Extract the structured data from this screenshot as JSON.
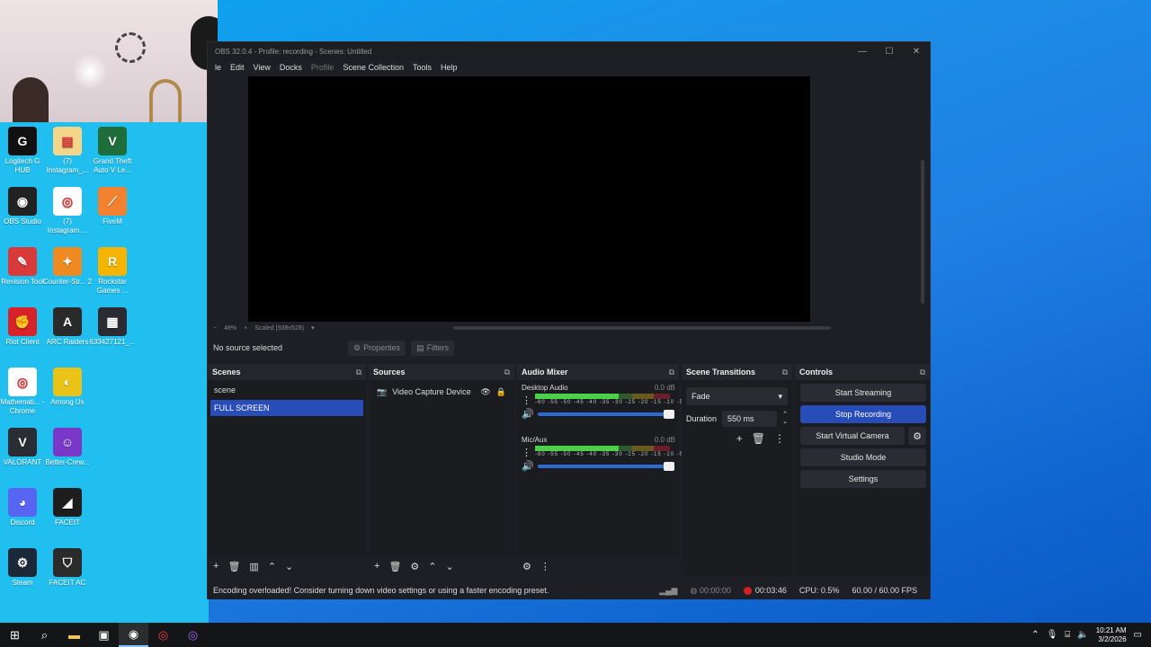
{
  "window": {
    "title": "OBS 32.0.4 - Profile: recording - Scenes: Untitled"
  },
  "menu": [
    "le",
    "Edit",
    "View",
    "Docks",
    "Profile",
    "Scene Collection",
    "Tools",
    "Help"
  ],
  "preview": {
    "zoom": "48%",
    "scale_mode": "Scaled (939x528)"
  },
  "source_bar": {
    "status": "No source selected",
    "properties": "Properties",
    "filters": "Filters"
  },
  "scenes": {
    "title": "Scenes",
    "items": [
      "scene",
      "FULL SCREEN"
    ],
    "selected": 1
  },
  "sources": {
    "title": "Sources",
    "items": [
      "Video Capture Device"
    ]
  },
  "mixer": {
    "title": "Audio Mixer",
    "channels": [
      {
        "name": "Desktop Audio",
        "db": "0.0 dB",
        "level": 0.62
      },
      {
        "name": "Mic/Aux",
        "db": "0.0 dB",
        "level": 0.62
      }
    ],
    "ticks": "-60 -55 -50 -45 -40 -35 -30 -25 -20 -15 -10 -5 0"
  },
  "transitions": {
    "title": "Scene Transitions",
    "type": "Fade",
    "duration_label": "Duration",
    "duration": "550 ms"
  },
  "controls": {
    "title": "Controls",
    "start_streaming": "Start Streaming",
    "stop_recording": "Stop Recording",
    "start_virtual_camera": "Start Virtual Camera",
    "studio_mode": "Studio Mode",
    "settings": "Settings"
  },
  "status": {
    "message": "Encoding overloaded! Consider turning down video settings or using a faster encoding preset.",
    "stream_time": "00:00:00",
    "rec_time": "00:03:46",
    "cpu": "CPU: 0.5%",
    "fps": "60.00 / 60.00 FPS"
  },
  "desktop_icons": [
    {
      "label": "Logitech G HUB",
      "color": "#111",
      "glyph": "G"
    },
    {
      "label": "(7) Instagram_...",
      "color": "#f4d68a",
      "glyph": "▤"
    },
    {
      "label": "Grand Theft Auto V Le...",
      "color": "#1f6d3a",
      "glyph": "V"
    },
    {
      "label": "OBS Studio",
      "color": "#222",
      "glyph": "◉"
    },
    {
      "label": "(7) Instagram....",
      "color": "#ffffff",
      "glyph": "◎"
    },
    {
      "label": "FiveM",
      "color": "#f2822f",
      "glyph": "⟋"
    },
    {
      "label": "Revision Tool",
      "color": "#d83a3a",
      "glyph": "✎"
    },
    {
      "label": "Counter-Str... 2",
      "color": "#ef8a22",
      "glyph": "✦"
    },
    {
      "label": "Rockstar Games ...",
      "color": "#f5b400",
      "glyph": "R"
    },
    {
      "label": "Riot Client",
      "color": "#d8222a",
      "glyph": "✊"
    },
    {
      "label": "ARC Raiders",
      "color": "#2a2a2a",
      "glyph": "A"
    },
    {
      "label": "633427121_...",
      "color": "#2b2b33",
      "glyph": "▦"
    },
    {
      "label": "Mathemati... - Chrome",
      "color": "#ffffff",
      "glyph": "◎"
    },
    {
      "label": "Among Us",
      "color": "#e9c318",
      "glyph": "◐"
    },
    {
      "label": "VALORANT",
      "color": "#2a2d33",
      "glyph": "V"
    },
    {
      "label": "Better-Crew...",
      "color": "#7a38c9",
      "glyph": "☺"
    },
    {
      "label": "Discord",
      "color": "#5865f2",
      "glyph": "◕"
    },
    {
      "label": "FACEIT",
      "color": "#1d1d1d",
      "glyph": "◢"
    },
    {
      "label": "Steam",
      "color": "#1b2838",
      "glyph": "⚙"
    },
    {
      "label": "FACEIT AC",
      "color": "#2b2b2b",
      "glyph": "⛉"
    }
  ],
  "taskbar": {
    "time": "10:21 AM",
    "date": "3/2/2026"
  },
  "colors": {
    "accent": "#284cb8",
    "rec": "#d42020",
    "desktop": "#21bff0"
  }
}
